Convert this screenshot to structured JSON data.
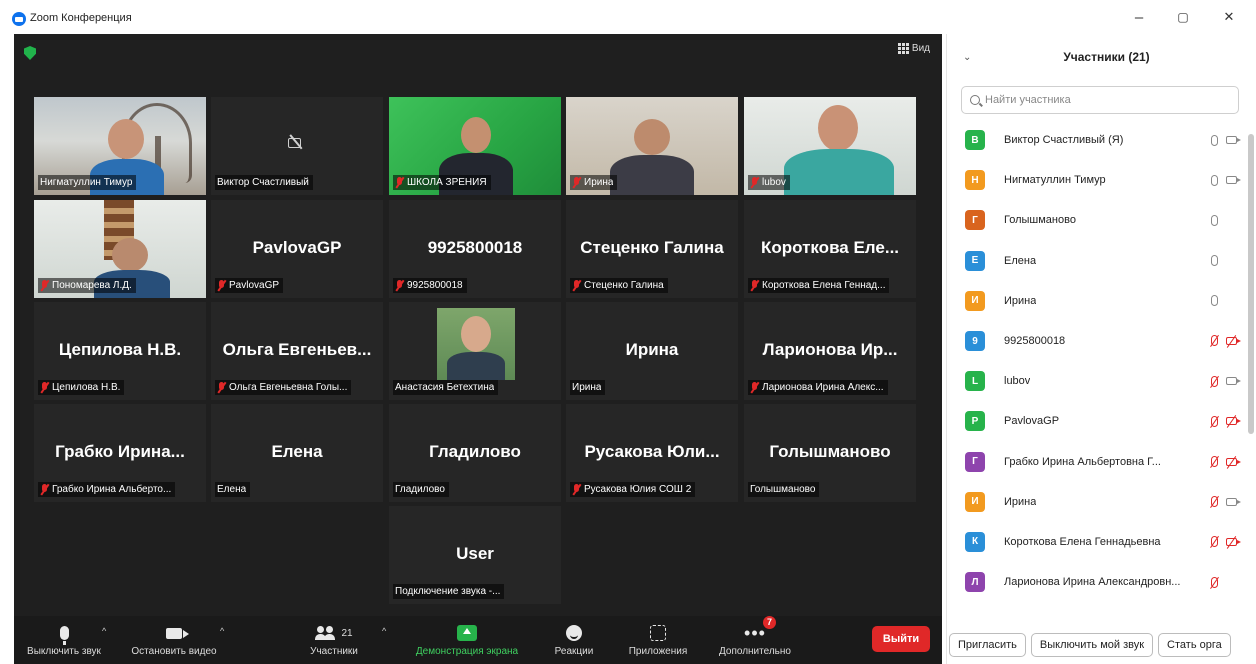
{
  "window": {
    "title": "Zoom Конференция",
    "minimize_glyph": "–",
    "restore_glyph": "▢",
    "close_glyph": "✕"
  },
  "meeting": {
    "view_label": "Вид",
    "tiles": [
      {
        "label": "Нигматуллин Тимур",
        "center": "",
        "muted": false,
        "video": "room",
        "speaking": true
      },
      {
        "label": "Виктор Счастливый",
        "center": "",
        "muted": false,
        "video": "off"
      },
      {
        "label": "ШКОЛА ЗРЕНИЯ",
        "center": "",
        "muted": true,
        "video": "green"
      },
      {
        "label": "Ирина",
        "center": "",
        "muted": true,
        "video": "office"
      },
      {
        "label": "lubov",
        "center": "",
        "muted": true,
        "video": "light"
      },
      {
        "label": "Пономарева Л.Д.",
        "center": "",
        "muted": true,
        "video": "shelf"
      },
      {
        "label": "PavlovaGP",
        "center": "PavlovaGP",
        "muted": true,
        "video": "none"
      },
      {
        "label": "9925800018",
        "center": "9925800018",
        "muted": true,
        "video": "none"
      },
      {
        "label": "Стеценко Галина",
        "center": "Стеценко Галина",
        "muted": true,
        "video": "none"
      },
      {
        "label": "Короткова Елена Геннад...",
        "center": "Короткова Еле...",
        "muted": true,
        "video": "none"
      },
      {
        "label": "Цепилова Н.В.",
        "center": "Цепилова Н.В.",
        "muted": true,
        "video": "none"
      },
      {
        "label": "Ольга Евгеньевна Голы...",
        "center": "Ольга Евгеньев...",
        "muted": true,
        "video": "none"
      },
      {
        "label": "Анастасия Бетехтина",
        "center": "",
        "muted": false,
        "video": "photo"
      },
      {
        "label": "Ирина",
        "center": "Ирина",
        "muted": false,
        "video": "none"
      },
      {
        "label": "Ларионова Ирина Алекс...",
        "center": "Ларионова Ир...",
        "muted": true,
        "video": "none"
      },
      {
        "label": "Грабко Ирина Альберто...",
        "center": "Грабко Ирина...",
        "muted": true,
        "video": "none"
      },
      {
        "label": "Елена",
        "center": "Елена",
        "muted": false,
        "video": "none"
      },
      {
        "label": "Гладилово",
        "center": "Гладилово",
        "muted": false,
        "video": "none"
      },
      {
        "label": "Русакова Юлия СОШ 2",
        "center": "Русакова Юли...",
        "muted": true,
        "video": "none"
      },
      {
        "label": "Голышманово",
        "center": "Голышманово",
        "muted": false,
        "video": "none"
      },
      {
        "label": "Подключение звука -...",
        "center": "User",
        "muted": false,
        "video": "none"
      }
    ]
  },
  "toolbar": {
    "mute_label": "Выключить звук",
    "video_label": "Остановить видео",
    "participants_label": "Участники",
    "participants_count": "21",
    "share_label": "Демонстрация экрана",
    "reactions_label": "Реакции",
    "apps_label": "Приложения",
    "more_label": "Дополнительно",
    "more_badge": "7",
    "leave_label": "Выйти",
    "caret": "^"
  },
  "panel": {
    "title": "Участники (21)",
    "collapse_glyph": "⌄",
    "search_placeholder": "Найти участника",
    "participants": [
      {
        "initial": "В",
        "name": "Виктор Счастливый (Я)",
        "color": "#27b34b",
        "mic": "on",
        "cam": "on"
      },
      {
        "initial": "Н",
        "name": "Нигматуллин Тимур",
        "color": "#f29a1f",
        "mic": "on",
        "cam": "on"
      },
      {
        "initial": "Г",
        "name": "Голышманово",
        "color": "#d9641e",
        "mic": "on",
        "cam": "none"
      },
      {
        "initial": "Е",
        "name": "Елена",
        "color": "#2a8fd8",
        "mic": "on",
        "cam": "none"
      },
      {
        "initial": "И",
        "name": "Ирина",
        "color": "#f29a1f",
        "mic": "on",
        "cam": "none"
      },
      {
        "initial": "9",
        "name": "9925800018",
        "color": "#2a8fd8",
        "mic": "muted",
        "cam": "muted"
      },
      {
        "initial": "L",
        "name": "lubov",
        "color": "#27b34b",
        "mic": "muted",
        "cam": "on"
      },
      {
        "initial": "P",
        "name": "PavlovaGP",
        "color": "#27b34b",
        "mic": "muted",
        "cam": "muted"
      },
      {
        "initial": "Г",
        "name": "Грабко Ирина Альбертовна Г...",
        "color": "#8e44ad",
        "mic": "muted",
        "cam": "muted"
      },
      {
        "initial": "И",
        "name": "Ирина",
        "color": "#f29a1f",
        "mic": "muted",
        "cam": "on"
      },
      {
        "initial": "К",
        "name": "Короткова Елена Геннадьевна",
        "color": "#2a8fd8",
        "mic": "muted",
        "cam": "muted"
      },
      {
        "initial": "Л",
        "name": "Ларионова Ирина Александровн...",
        "color": "#8e44ad",
        "mic": "muted",
        "cam": "none"
      },
      {
        "initial": "",
        "name": "",
        "color": "#2a8fd8",
        "mic": "none",
        "cam": "none"
      }
    ],
    "footer": {
      "invite_label": "Пригласить",
      "mute_me_label": "Выключить мой звук",
      "more_label": "Стать орга"
    }
  },
  "colors": {
    "meeting_bg": "#1f1f1f",
    "tile_bg": "#262626",
    "speaking_outline": "#b9e06a",
    "leave_red": "#e02828",
    "share_green": "#27b34b"
  }
}
